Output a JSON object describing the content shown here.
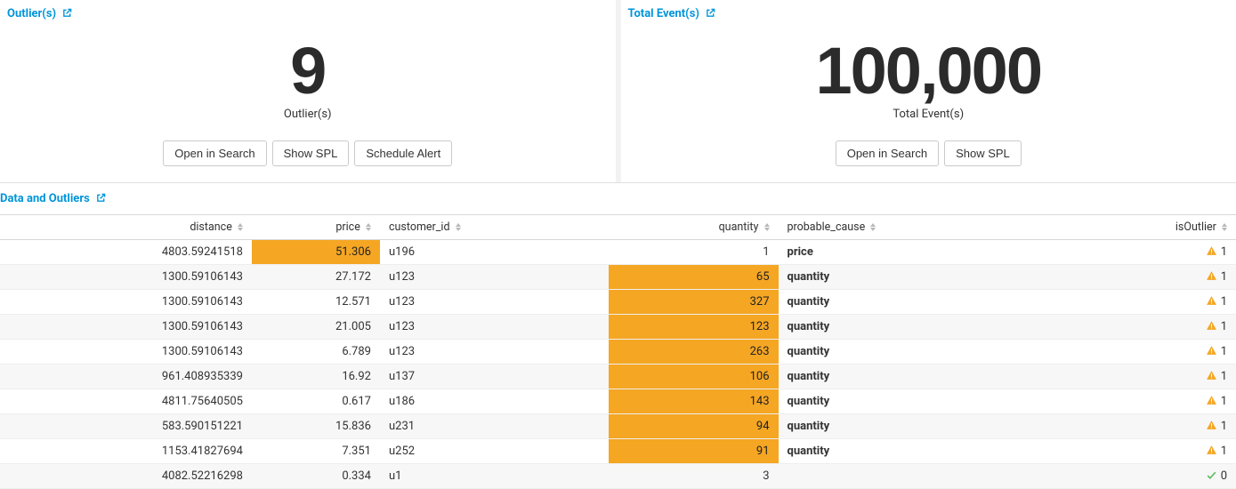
{
  "panels": {
    "outliers": {
      "title": "Outlier(s)",
      "value": "9",
      "caption": "Outlier(s)",
      "buttons": {
        "open": "Open in Search",
        "spl": "Show SPL",
        "alert": "Schedule Alert"
      }
    },
    "events": {
      "title": "Total Event(s)",
      "value": "100,000",
      "caption": "Total Event(s)",
      "buttons": {
        "open": "Open in Search",
        "spl": "Show SPL"
      }
    }
  },
  "table": {
    "title": "Data and Outliers",
    "columns": {
      "distance": "distance",
      "price": "price",
      "customer_id": "customer_id",
      "quantity": "quantity",
      "probable_cause": "probable_cause",
      "isOutlier": "isOutlier"
    },
    "rows": [
      {
        "distance": "4803.59241518",
        "price": "51.306",
        "price_hl": true,
        "customer_id": "u196",
        "quantity": "1",
        "quantity_hl": false,
        "probable_cause": "price",
        "isOutlier": "1",
        "warn": true
      },
      {
        "distance": "1300.59106143",
        "price": "27.172",
        "price_hl": false,
        "customer_id": "u123",
        "quantity": "65",
        "quantity_hl": true,
        "probable_cause": "quantity",
        "isOutlier": "1",
        "warn": true
      },
      {
        "distance": "1300.59106143",
        "price": "12.571",
        "price_hl": false,
        "customer_id": "u123",
        "quantity": "327",
        "quantity_hl": true,
        "probable_cause": "quantity",
        "isOutlier": "1",
        "warn": true
      },
      {
        "distance": "1300.59106143",
        "price": "21.005",
        "price_hl": false,
        "customer_id": "u123",
        "quantity": "123",
        "quantity_hl": true,
        "probable_cause": "quantity",
        "isOutlier": "1",
        "warn": true
      },
      {
        "distance": "1300.59106143",
        "price": "6.789",
        "price_hl": false,
        "customer_id": "u123",
        "quantity": "263",
        "quantity_hl": true,
        "probable_cause": "quantity",
        "isOutlier": "1",
        "warn": true
      },
      {
        "distance": "961.408935339",
        "price": "16.92",
        "price_hl": false,
        "customer_id": "u137",
        "quantity": "106",
        "quantity_hl": true,
        "probable_cause": "quantity",
        "isOutlier": "1",
        "warn": true
      },
      {
        "distance": "4811.75640505",
        "price": "0.617",
        "price_hl": false,
        "customer_id": "u186",
        "quantity": "143",
        "quantity_hl": true,
        "probable_cause": "quantity",
        "isOutlier": "1",
        "warn": true
      },
      {
        "distance": "583.590151221",
        "price": "15.836",
        "price_hl": false,
        "customer_id": "u231",
        "quantity": "94",
        "quantity_hl": true,
        "probable_cause": "quantity",
        "isOutlier": "1",
        "warn": true
      },
      {
        "distance": "1153.41827694",
        "price": "7.351",
        "price_hl": false,
        "customer_id": "u252",
        "quantity": "91",
        "quantity_hl": true,
        "probable_cause": "quantity",
        "isOutlier": "1",
        "warn": true
      },
      {
        "distance": "4082.52216298",
        "price": "0.334",
        "price_hl": false,
        "customer_id": "u1",
        "quantity": "3",
        "quantity_hl": false,
        "probable_cause": "",
        "isOutlier": "0",
        "warn": false
      }
    ]
  }
}
